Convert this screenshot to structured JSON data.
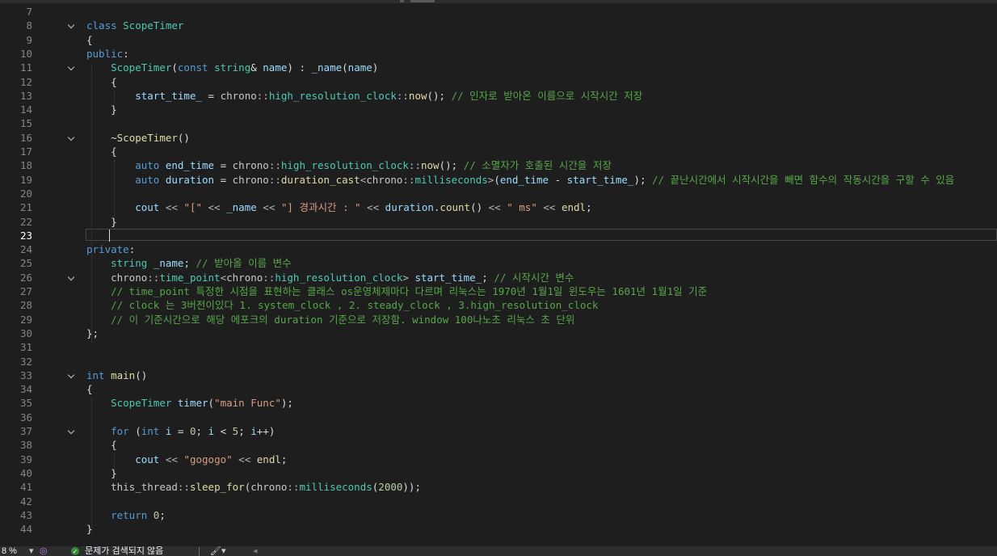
{
  "editor": {
    "current_line": 23,
    "lines": [
      {
        "n": "7",
        "fold": false,
        "tokens": []
      },
      {
        "n": "8",
        "fold": true,
        "tokens": [
          [
            "kw",
            "class "
          ],
          [
            "type",
            "ScopeTimer"
          ]
        ]
      },
      {
        "n": "9",
        "fold": false,
        "tokens": [
          [
            "pl",
            "{"
          ]
        ]
      },
      {
        "n": "10",
        "fold": false,
        "tokens": [
          [
            "kw",
            "public"
          ],
          [
            "pl",
            ":"
          ]
        ]
      },
      {
        "n": "11",
        "fold": true,
        "tokens": [
          [
            "pl",
            "    "
          ],
          [
            "type",
            "ScopeTimer"
          ],
          [
            "pl",
            "("
          ],
          [
            "kw",
            "const "
          ],
          [
            "type",
            "string"
          ],
          [
            "pl",
            "& "
          ],
          [
            "var",
            "name"
          ],
          [
            "pl",
            ") : "
          ],
          [
            "var",
            "_name"
          ],
          [
            "pl",
            "("
          ],
          [
            "var",
            "name"
          ],
          [
            "pl",
            ")"
          ]
        ]
      },
      {
        "n": "12",
        "fold": false,
        "tokens": [
          [
            "pl",
            "    {"
          ]
        ]
      },
      {
        "n": "13",
        "fold": false,
        "tokens": [
          [
            "pl",
            "        "
          ],
          [
            "var",
            "start_time_"
          ],
          [
            "pl",
            " = "
          ],
          [
            "ns",
            "chrono"
          ],
          [
            "op",
            "::"
          ],
          [
            "type",
            "high_resolution_clock"
          ],
          [
            "op",
            "::"
          ],
          [
            "fn",
            "now"
          ],
          [
            "pl",
            "(); "
          ],
          [
            "cm",
            "// 인자로 받아온 이름으로 시작시간 저장"
          ]
        ]
      },
      {
        "n": "14",
        "fold": false,
        "tokens": [
          [
            "pl",
            "    }"
          ]
        ]
      },
      {
        "n": "15",
        "fold": false,
        "tokens": []
      },
      {
        "n": "16",
        "fold": true,
        "tokens": [
          [
            "pl",
            "    ~"
          ],
          [
            "fn",
            "ScopeTimer"
          ],
          [
            "pl",
            "()"
          ]
        ]
      },
      {
        "n": "17",
        "fold": false,
        "tokens": [
          [
            "pl",
            "    {"
          ]
        ]
      },
      {
        "n": "18",
        "fold": false,
        "tokens": [
          [
            "pl",
            "        "
          ],
          [
            "kw",
            "auto "
          ],
          [
            "var",
            "end_time"
          ],
          [
            "pl",
            " = "
          ],
          [
            "ns",
            "chrono"
          ],
          [
            "op",
            "::"
          ],
          [
            "type",
            "high_resolution_clock"
          ],
          [
            "op",
            "::"
          ],
          [
            "fn",
            "now"
          ],
          [
            "pl",
            "(); "
          ],
          [
            "cm",
            "// 소멸자가 호출된 시간을 저장"
          ]
        ]
      },
      {
        "n": "19",
        "fold": false,
        "tokens": [
          [
            "pl",
            "        "
          ],
          [
            "kw",
            "auto "
          ],
          [
            "var",
            "duration"
          ],
          [
            "pl",
            " = "
          ],
          [
            "ns",
            "chrono"
          ],
          [
            "op",
            "::"
          ],
          [
            "fn",
            "duration_cast"
          ],
          [
            "op",
            "<"
          ],
          [
            "ns",
            "chrono"
          ],
          [
            "op",
            "::"
          ],
          [
            "type",
            "milliseconds"
          ],
          [
            "op",
            ">"
          ],
          [
            "pl",
            "("
          ],
          [
            "var",
            "end_time"
          ],
          [
            "pl",
            " - "
          ],
          [
            "var",
            "start_time_"
          ],
          [
            "pl",
            "); "
          ],
          [
            "cm",
            "// 끝난시간에서 시작시간을 빼면 함수의 작동시간을 구할 수 있음"
          ]
        ]
      },
      {
        "n": "20",
        "fold": false,
        "tokens": []
      },
      {
        "n": "21",
        "fold": false,
        "tokens": [
          [
            "pl",
            "        "
          ],
          [
            "var",
            "cout"
          ],
          [
            "op",
            " << "
          ],
          [
            "str",
            "\"[\""
          ],
          [
            "op",
            " << "
          ],
          [
            "var",
            "_name"
          ],
          [
            "op",
            " << "
          ],
          [
            "str",
            "\"] 경과시간 : \""
          ],
          [
            "op",
            " << "
          ],
          [
            "var",
            "duration"
          ],
          [
            "pl",
            "."
          ],
          [
            "fn",
            "count"
          ],
          [
            "pl",
            "()"
          ],
          [
            "op",
            " << "
          ],
          [
            "str",
            "\" ms\""
          ],
          [
            "op",
            " << "
          ],
          [
            "fn",
            "endl"
          ],
          [
            "pl",
            ";"
          ]
        ]
      },
      {
        "n": "22",
        "fold": false,
        "tokens": [
          [
            "pl",
            "    }"
          ]
        ]
      },
      {
        "n": "23",
        "fold": false,
        "tokens": []
      },
      {
        "n": "24",
        "fold": false,
        "tokens": [
          [
            "kw",
            "private"
          ],
          [
            "pl",
            ":"
          ]
        ]
      },
      {
        "n": "25",
        "fold": false,
        "tokens": [
          [
            "pl",
            "    "
          ],
          [
            "type",
            "string "
          ],
          [
            "var",
            "_name"
          ],
          [
            "pl",
            "; "
          ],
          [
            "cm",
            "// 받아올 이름 변수"
          ]
        ]
      },
      {
        "n": "26",
        "fold": true,
        "tokens": [
          [
            "pl",
            "    "
          ],
          [
            "ns",
            "chrono"
          ],
          [
            "op",
            "::"
          ],
          [
            "type",
            "time_point"
          ],
          [
            "op",
            "<"
          ],
          [
            "ns",
            "chrono"
          ],
          [
            "op",
            "::"
          ],
          [
            "type",
            "high_resolution_clock"
          ],
          [
            "op",
            "> "
          ],
          [
            "var",
            "start_time_"
          ],
          [
            "pl",
            "; "
          ],
          [
            "cm",
            "// 시작시간 변수"
          ]
        ]
      },
      {
        "n": "27",
        "fold": false,
        "tokens": [
          [
            "pl",
            "    "
          ],
          [
            "cm",
            "// time_point 특정한 시점을 표현하는 클래스 os운영체제마다 다르며 리눅스는 1970년 1월1일 윈도우는 1601년 1월1일 기준"
          ]
        ]
      },
      {
        "n": "28",
        "fold": false,
        "tokens": [
          [
            "pl",
            "    "
          ],
          [
            "cm",
            "// clock 는 3버전이있다 1. system_clock , 2. steady_clock , 3.high_resolution_clock"
          ]
        ]
      },
      {
        "n": "29",
        "fold": false,
        "tokens": [
          [
            "pl",
            "    "
          ],
          [
            "cm",
            "// 이 기준시간으로 해당 에포크의 duration 기준으로 저장함. window 100나노초 리눅스 초 단위"
          ]
        ]
      },
      {
        "n": "30",
        "fold": false,
        "tokens": [
          [
            "pl",
            "};"
          ]
        ]
      },
      {
        "n": "31",
        "fold": false,
        "tokens": []
      },
      {
        "n": "32",
        "fold": false,
        "tokens": []
      },
      {
        "n": "33",
        "fold": true,
        "tokens": [
          [
            "kw",
            "int "
          ],
          [
            "fn",
            "main"
          ],
          [
            "pl",
            "()"
          ]
        ]
      },
      {
        "n": "34",
        "fold": false,
        "tokens": [
          [
            "pl",
            "{"
          ]
        ]
      },
      {
        "n": "35",
        "fold": false,
        "tokens": [
          [
            "pl",
            "    "
          ],
          [
            "type",
            "ScopeTimer "
          ],
          [
            "var",
            "timer"
          ],
          [
            "pl",
            "("
          ],
          [
            "str",
            "\"main Func\""
          ],
          [
            "pl",
            ");"
          ]
        ]
      },
      {
        "n": "36",
        "fold": false,
        "tokens": []
      },
      {
        "n": "37",
        "fold": true,
        "tokens": [
          [
            "pl",
            "    "
          ],
          [
            "kw",
            "for"
          ],
          [
            "pl",
            " ("
          ],
          [
            "kw",
            "int "
          ],
          [
            "var",
            "i"
          ],
          [
            "pl",
            " = "
          ],
          [
            "num",
            "0"
          ],
          [
            "pl",
            "; "
          ],
          [
            "var",
            "i"
          ],
          [
            "pl",
            " < "
          ],
          [
            "num",
            "5"
          ],
          [
            "pl",
            "; "
          ],
          [
            "var",
            "i"
          ],
          [
            "pl",
            "++)"
          ]
        ]
      },
      {
        "n": "38",
        "fold": false,
        "tokens": [
          [
            "pl",
            "    {"
          ]
        ]
      },
      {
        "n": "39",
        "fold": false,
        "tokens": [
          [
            "pl",
            "        "
          ],
          [
            "var",
            "cout"
          ],
          [
            "op",
            " << "
          ],
          [
            "str",
            "\"gogogo\""
          ],
          [
            "op",
            " << "
          ],
          [
            "fn",
            "endl"
          ],
          [
            "pl",
            ";"
          ]
        ]
      },
      {
        "n": "40",
        "fold": false,
        "tokens": [
          [
            "pl",
            "    }"
          ]
        ]
      },
      {
        "n": "41",
        "fold": false,
        "tokens": [
          [
            "pl",
            "    "
          ],
          [
            "ns",
            "this_thread"
          ],
          [
            "op",
            "::"
          ],
          [
            "fn",
            "sleep_for"
          ],
          [
            "pl",
            "("
          ],
          [
            "ns",
            "chrono"
          ],
          [
            "op",
            "::"
          ],
          [
            "type",
            "milliseconds"
          ],
          [
            "pl",
            "("
          ],
          [
            "num",
            "2000"
          ],
          [
            "pl",
            "));"
          ]
        ]
      },
      {
        "n": "42",
        "fold": false,
        "tokens": []
      },
      {
        "n": "43",
        "fold": false,
        "tokens": [
          [
            "pl",
            "    "
          ],
          [
            "kw",
            "return "
          ],
          [
            "num",
            "0"
          ],
          [
            "pl",
            ";"
          ]
        ]
      },
      {
        "n": "44",
        "fold": false,
        "tokens": [
          [
            "pl",
            "}"
          ]
        ]
      }
    ]
  },
  "status": {
    "zoom": "8 %",
    "issues_text": "문제가 검색되지 않음"
  },
  "colors": {
    "background": "#1e1e1e",
    "keyword": "#569cd6",
    "type": "#4ec9b0",
    "function": "#dcdcaa",
    "comment": "#57a64a",
    "string": "#d69d85",
    "number": "#b5cea8"
  }
}
